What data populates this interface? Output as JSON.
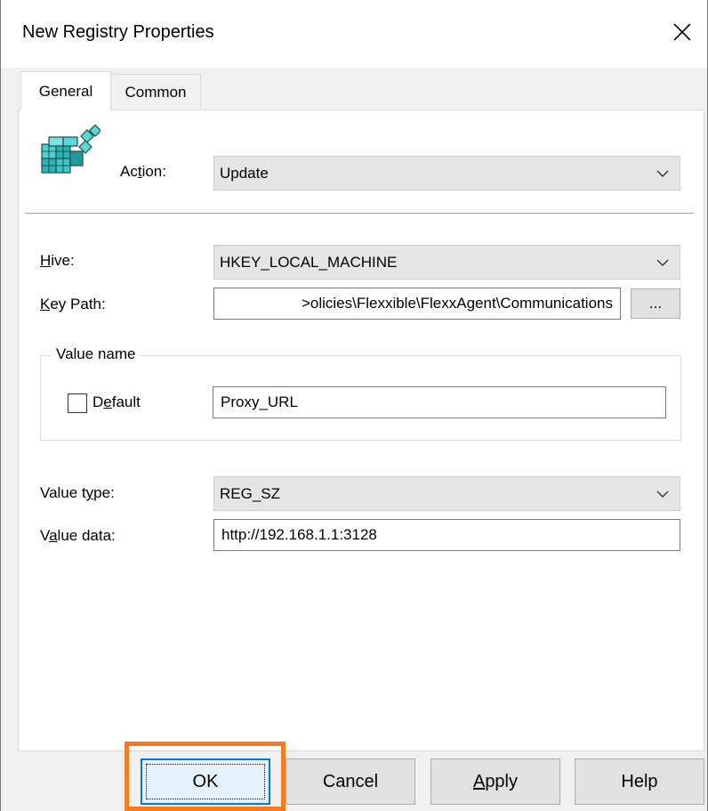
{
  "window": {
    "title": "New Registry Properties"
  },
  "tabs": [
    {
      "label": "General",
      "active": true
    },
    {
      "label": "Common",
      "active": false
    }
  ],
  "general": {
    "icon": "registry-cubes-icon",
    "action": {
      "label_pre": "Ac",
      "label_ul": "t",
      "label_post": "ion:",
      "value": "Update"
    },
    "hive": {
      "label_ul": "H",
      "label_post": "ive:",
      "value": "HKEY_LOCAL_MACHINE"
    },
    "key_path": {
      "label_ul": "K",
      "label_post": "ey Path:",
      "value": ">olicies\\Flexxible\\FlexxAgent\\Communications",
      "browse_label": "..."
    },
    "value_name": {
      "legend": "Value name",
      "default_label_pre": "D",
      "default_label_ul": "e",
      "default_label_post": "fault",
      "default_checked": false,
      "value": "Proxy_URL"
    },
    "value_type": {
      "label_pre": "Value t",
      "label_ul": "y",
      "label_post": "pe:",
      "value": "REG_SZ"
    },
    "value_data": {
      "label_pre": "V",
      "label_ul": "a",
      "label_post": "lue data:",
      "value": "http://192.168.1.1:3128"
    }
  },
  "buttons": {
    "ok": "OK",
    "cancel": "Cancel",
    "apply_ul": "A",
    "apply_post": "pply",
    "help": "Help"
  },
  "colors": {
    "highlight": "#f47b20",
    "focus": "#0078d7"
  }
}
